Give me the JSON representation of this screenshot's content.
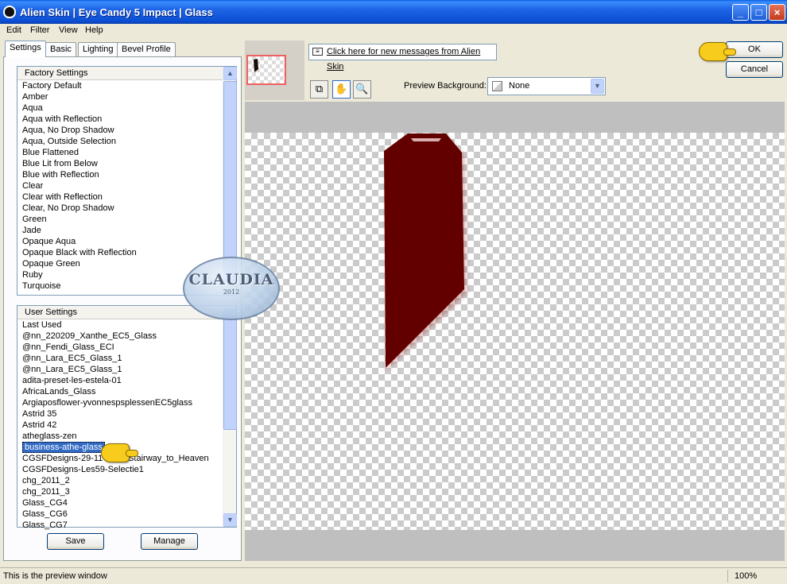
{
  "window": {
    "title": "Alien Skin  |  Eye Candy 5 Impact  |  Glass",
    "minimize_glyph": "_",
    "maximize_glyph": "□",
    "close_glyph": "×"
  },
  "menu": [
    "Edit",
    "Filter",
    "View",
    "Help"
  ],
  "tabs": [
    "Settings",
    "Basic",
    "Lighting",
    "Bevel Profile"
  ],
  "factory_settings": {
    "header": "Factory Settings",
    "items": [
      "Factory Default",
      "Amber",
      "Aqua",
      "Aqua with Reflection",
      "Aqua, No Drop Shadow",
      "Aqua, Outside Selection",
      "Blue Flattened",
      "Blue Lit from Below",
      "Blue with Reflection",
      "Clear",
      "Clear with Reflection",
      "Clear, No Drop Shadow",
      "Green",
      "Jade",
      "Opaque Aqua",
      "Opaque Black with Reflection",
      "Opaque Green",
      "Ruby",
      "Turquoise"
    ]
  },
  "user_settings": {
    "header": "User Settings",
    "items": [
      "Last Used",
      "@nn_220209_Xanthe_EC5_Glass",
      "@nn_Fendi_Glass_ECI",
      "@nn_Lara_EC5_Glass_1",
      "@nn_Lara_EC5_Glass_1",
      "adita-preset-les-estela-01",
      "AfricaLands_Glass",
      "Argiaposflower-yvonnespsplessenEC5glass",
      "Astrid 35",
      "Astrid 42",
      "atheglass-zen",
      "business-athe-glass",
      "CGSFDesigns-29-11-2008-Stairway_to_Heaven",
      "CGSFDesigns-Les59-Selectie1",
      "chg_2011_2",
      "chg_2011_3",
      "Glass_CG4",
      "Glass_CG6",
      "Glass_CG7"
    ],
    "selected_index": 11
  },
  "buttons": {
    "save": "Save",
    "manage": "Manage",
    "ok": "OK",
    "cancel": "Cancel"
  },
  "messages_link": "Click here for new messages from Alien Skin",
  "preview_background": {
    "label": "Preview Background:",
    "value": "None"
  },
  "tools": {
    "preview_toggle": "⧉",
    "hand": "✋",
    "zoom": "🔍"
  },
  "status": {
    "text": "This is the preview window",
    "zoom": "100%"
  },
  "watermark": {
    "text": "CLAUDIA",
    "year": "2012"
  },
  "colors": {
    "shape_fill": "#620000",
    "selection": "#316ac5",
    "titlebar": "#0c4fd4"
  }
}
